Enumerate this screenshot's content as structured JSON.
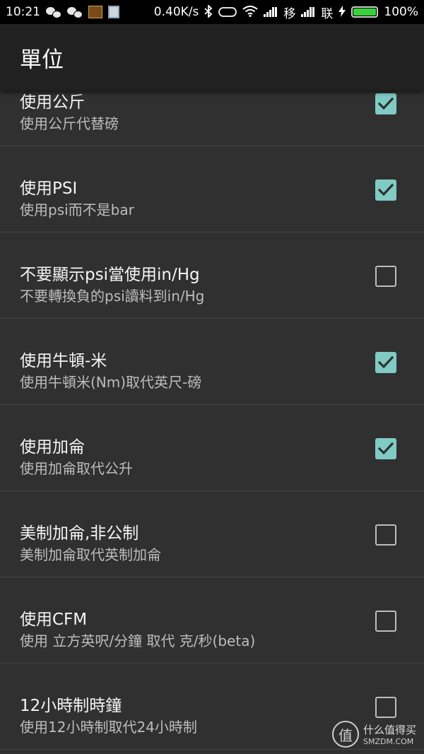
{
  "status_bar": {
    "time": "10:21",
    "network_speed": "0.40K/s",
    "carrier1": "移",
    "carrier2": "联",
    "battery": "100%",
    "icons": [
      "wechat-icon",
      "wechat-icon",
      "game-icon",
      "document-icon",
      "bluetooth-icon",
      "toggle-icon",
      "wifi-icon",
      "signal-icon",
      "signal-icon",
      "charging-icon",
      "battery-icon"
    ]
  },
  "app_bar": {
    "title": "單位"
  },
  "settings": [
    {
      "title": "使用公斤",
      "summary": "使用公斤代替磅",
      "checked": true
    },
    {
      "title": "使用PSI",
      "summary": "使用psi而不是bar",
      "checked": true
    },
    {
      "title": "不要顯示psi當使用in/Hg",
      "summary": "不要轉換負的psi讀料到in/Hg",
      "checked": false
    },
    {
      "title": "使用牛頓-米",
      "summary": "使用牛頓米(Nm)取代英尺-磅",
      "checked": true
    },
    {
      "title": "使用加侖",
      "summary": "使用加侖取代公升",
      "checked": true
    },
    {
      "title": "美制加侖,非公制",
      "summary": "美制加侖取代英制加侖",
      "checked": false
    },
    {
      "title": "使用CFM",
      "summary": "使用 立方英呎/分鐘 取代 克/秒(beta)",
      "checked": false
    },
    {
      "title": "12小時制時鐘",
      "summary": "使用12小時制取代24小時制",
      "checked": false
    }
  ],
  "watermark": {
    "logo_char": "值",
    "text_cn": "什么值得买",
    "text_en": "SMZDM.COM"
  },
  "colors": {
    "background": "#303030",
    "app_bar": "#212121",
    "checkbox_checked": "#80cbc4",
    "divider": "#454545"
  }
}
